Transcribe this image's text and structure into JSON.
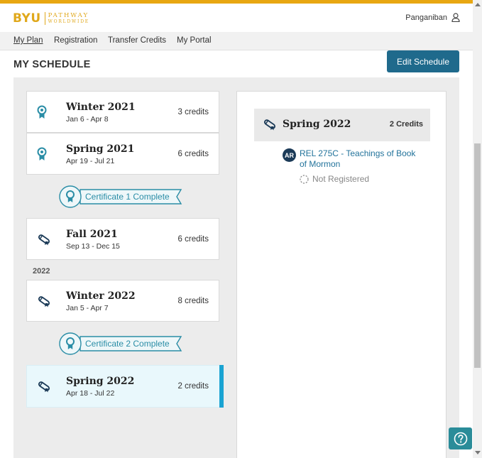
{
  "brand": {
    "name": "BYU",
    "line1": "PATHWAY",
    "line2": "WORLDWIDE",
    "color": "#e0a81b"
  },
  "user": {
    "name": "Panganiban"
  },
  "nav": {
    "items": [
      {
        "label": "My Plan",
        "active": true
      },
      {
        "label": "Registration"
      },
      {
        "label": "Transfer Credits"
      },
      {
        "label": "My Portal"
      }
    ]
  },
  "page": {
    "title": "MY SCHEDULE",
    "edit_button": "Edit Schedule"
  },
  "terms": [
    {
      "name": "Winter 2021",
      "dates": "Jan 6 - Apr 8",
      "credits": "3 credits",
      "icon": "certificate-ribbon-icon"
    },
    {
      "name": "Spring 2021",
      "dates": "Apr 19 - Jul 21",
      "credits": "6 credits",
      "icon": "certificate-ribbon-icon"
    },
    {
      "name": "Fall 2021",
      "dates": "Sep 13 - Dec 15",
      "credits": "6 credits",
      "icon": "diploma-icon"
    },
    {
      "name": "Winter 2022",
      "dates": "Jan 5 - Apr 7",
      "credits": "8 credits",
      "icon": "diploma-icon"
    },
    {
      "name": "Spring 2022",
      "dates": "Apr 18 - Jul 22",
      "credits": "2 credits",
      "icon": "diploma-icon",
      "selected": true
    }
  ],
  "year_label": "2022",
  "certificates": [
    {
      "label": "Certificate 1 Complete"
    },
    {
      "label": "Certificate 2 Complete"
    }
  ],
  "detail": {
    "term": "Spring 2022",
    "credits": "2 Credits",
    "course": {
      "badge": "AR",
      "title": "REL 275C - Teachings of Book of Mormon",
      "status": "Not Registered"
    }
  },
  "colors": {
    "accent": "#1f6a8c",
    "selected_bar": "#1aa3d2",
    "top_bar": "#e8a712",
    "teal": "#2a8da6"
  }
}
